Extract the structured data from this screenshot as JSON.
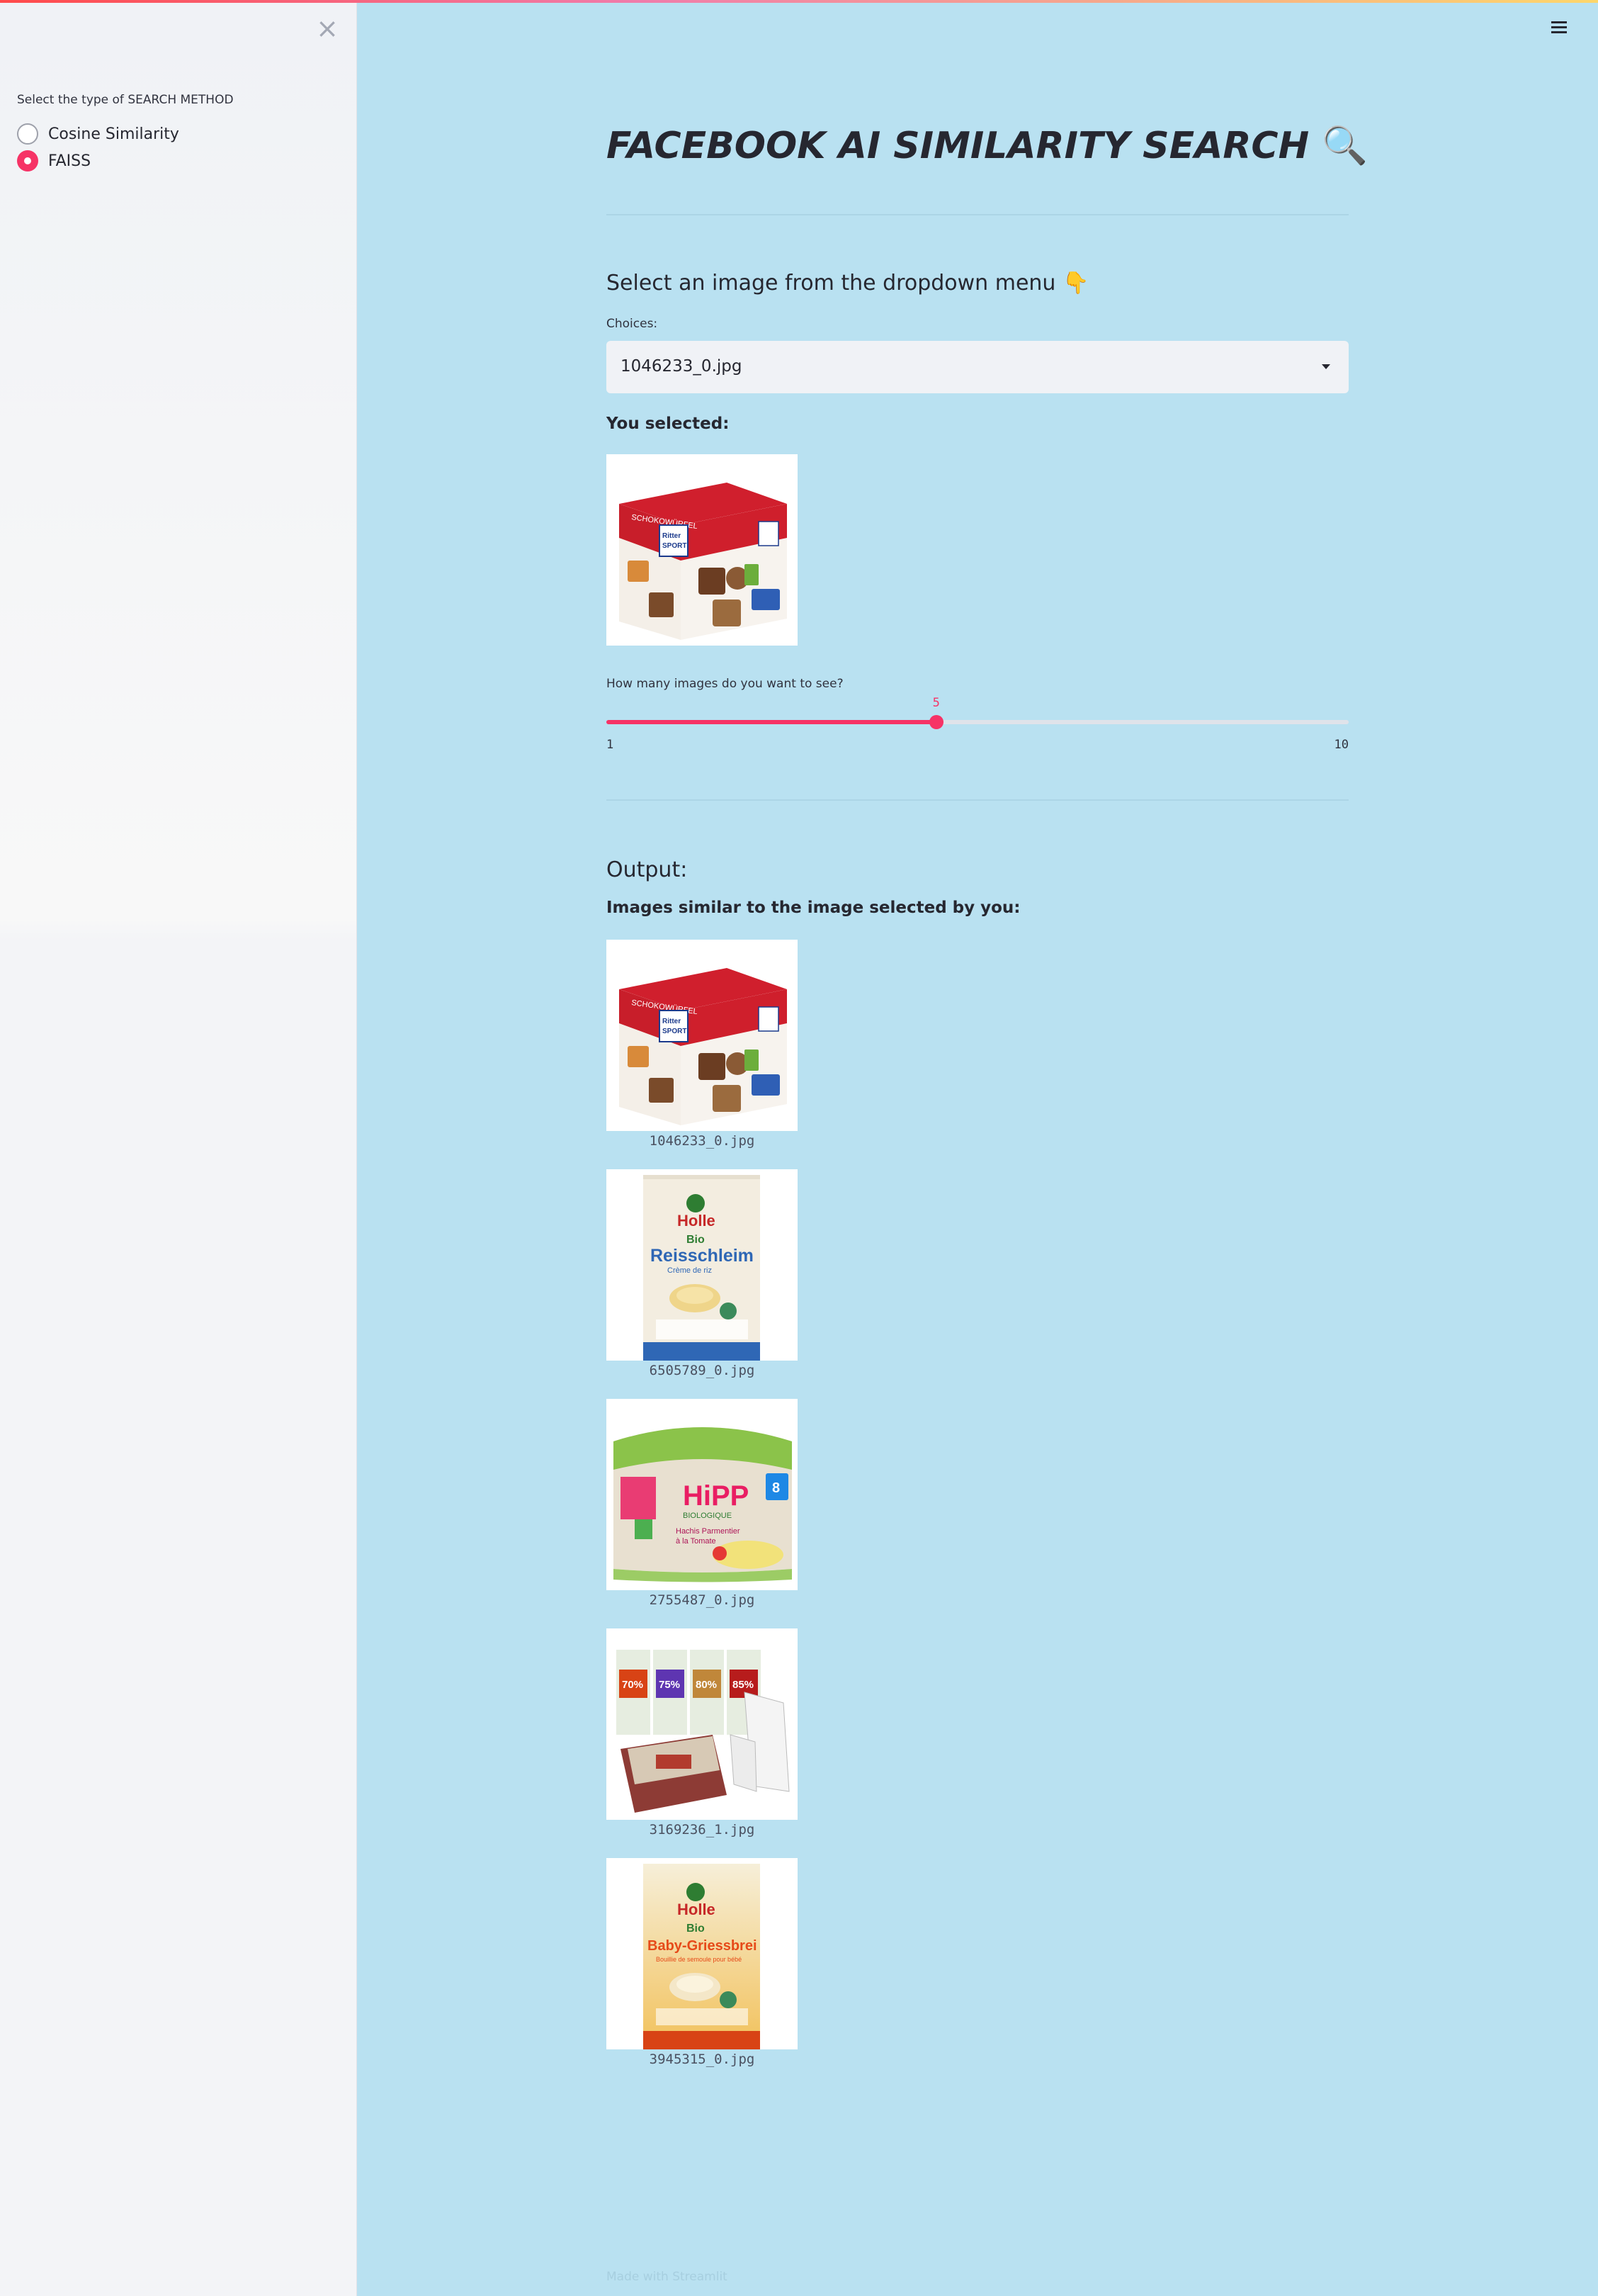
{
  "sidebar": {
    "close_icon": "close-icon",
    "radio_label": "Select the type of SEARCH METHOD",
    "options": [
      {
        "label": "Cosine Similarity",
        "checked": false
      },
      {
        "label": "FAISS",
        "checked": true
      }
    ]
  },
  "header": {
    "menu_icon": "hamburger-menu-icon"
  },
  "main": {
    "title": "FACEBOOK AI SIMILARITY SEARCH",
    "title_icon": "🔍",
    "select_header": "Select an image from the dropdown menu",
    "select_header_icon": "👇",
    "choices_label": "Choices:",
    "selected_value": "1046233_0.jpg",
    "you_selected_label": "You selected:",
    "slider": {
      "label": "How many images do you want to see?",
      "value": 5,
      "value_text": "5",
      "min": 1,
      "min_text": "1",
      "max": 10,
      "max_text": "10"
    },
    "output_header": "Output:",
    "similar_label": "Images similar to the image selected by you:",
    "results": [
      {
        "caption": "1046233_0.jpg",
        "product": "ritter-sport-box"
      },
      {
        "caption": "6505789_0.jpg",
        "product": "holle-reisschleim"
      },
      {
        "caption": "2755487_0.jpg",
        "product": "hipp-bowls"
      },
      {
        "caption": "3169236_1.jpg",
        "product": "chocolate-bars"
      },
      {
        "caption": "3945315_0.jpg",
        "product": "holle-griessbrei"
      }
    ],
    "product_text": {
      "ritter_brand_1": "Ritter",
      "ritter_brand_2": "SPORT",
      "ritter_name": "SCHOKOWÜRFEL",
      "holle_brand": "Holle",
      "holle_bio": "Bio",
      "reisschleim_name": "Reisschleim",
      "reisschleim_sub": "Crème de riz",
      "griess_name": "Baby-Griessbrei",
      "griess_sub": "Bouillie de semoule pour bébé",
      "hipp_brand": "HiPP",
      "hipp_sub": "BIOLOGIQUE",
      "hipp_age": "8",
      "hipp_desc_1": "Hachis Parmentier",
      "hipp_desc_2": "à la Tomate",
      "choc_pct": [
        "70%",
        "75%",
        "80%",
        "85%"
      ]
    },
    "footer": "Made with Streamlit"
  },
  "colors": {
    "accent": "#f63366",
    "main_bg": "#b9e1f1",
    "sidebar_bg": "#f0f2f6"
  }
}
